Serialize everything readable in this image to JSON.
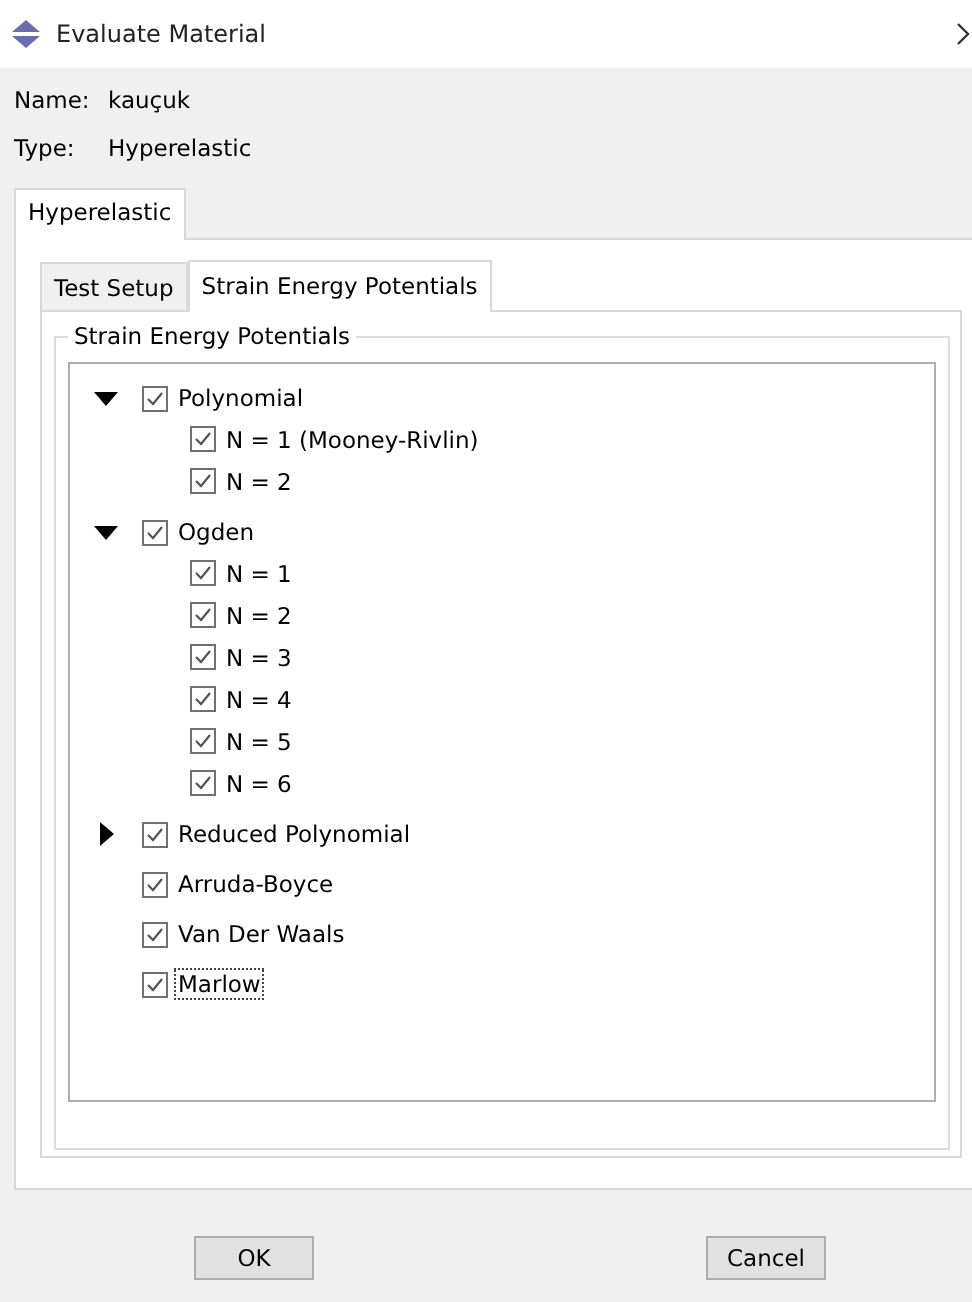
{
  "window": {
    "title": "Evaluate Material"
  },
  "fields": [
    {
      "label": "Name:",
      "value": "kauçuk"
    },
    {
      "label": "Type:",
      "value": "Hyperelastic"
    }
  ],
  "outer_tabs": [
    {
      "label": "Hyperelastic",
      "selected": true
    }
  ],
  "inner_tabs": [
    {
      "label": "Test Setup",
      "selected": false
    },
    {
      "label": "Strain Energy Potentials",
      "selected": true
    }
  ],
  "group": {
    "title": "Strain Energy Potentials",
    "tree": [
      {
        "label": "Polynomial",
        "checked": true,
        "expanded": true,
        "focused": false,
        "children": [
          {
            "label": "N = 1 (Mooney-Rivlin)",
            "checked": true
          },
          {
            "label": "N = 2",
            "checked": true
          }
        ]
      },
      {
        "label": "Ogden",
        "checked": true,
        "expanded": true,
        "focused": false,
        "children": [
          {
            "label": "N = 1",
            "checked": true
          },
          {
            "label": "N = 2",
            "checked": true
          },
          {
            "label": "N = 3",
            "checked": true
          },
          {
            "label": "N = 4",
            "checked": true
          },
          {
            "label": "N = 5",
            "checked": true
          },
          {
            "label": "N = 6",
            "checked": true
          }
        ]
      },
      {
        "label": "Reduced Polynomial",
        "checked": true,
        "expanded": false,
        "focused": false
      },
      {
        "label": "Arruda-Boyce",
        "checked": true,
        "focused": false
      },
      {
        "label": "Van Der Waals",
        "checked": true,
        "focused": false
      },
      {
        "label": "Marlow",
        "checked": true,
        "focused": true
      }
    ]
  },
  "buttons": [
    "OK",
    "Cancel"
  ]
}
